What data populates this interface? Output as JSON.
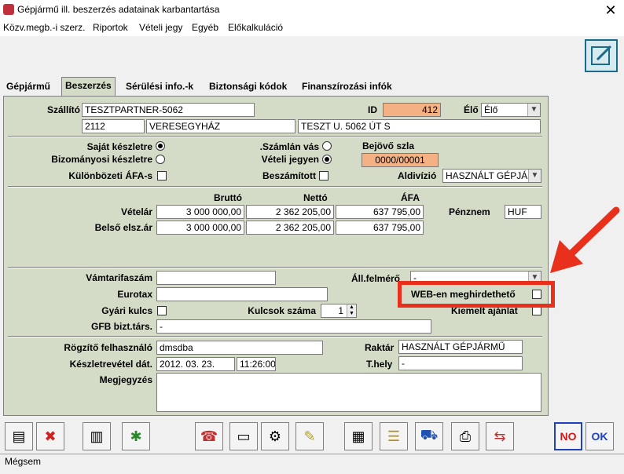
{
  "window": {
    "title": "Gépjármű ill. beszerzés adatainak karbantartása",
    "close": "✕"
  },
  "menu": [
    "Közv.megb.-i szerz.",
    "Riportok",
    "Vételi jegy",
    "Egyéb",
    "Előkalkuláció"
  ],
  "tabs": [
    "Gépjármű",
    "Beszerzés",
    "Sérülési info.-k",
    "Biztonsági kódok",
    "Finanszírozási infók"
  ],
  "active_tab": "Beszerzés",
  "supplier": {
    "label": "Szállító",
    "name": "TESZTPARTNER-5062",
    "zip": "2112",
    "city": "VERESEGYHÁZ",
    "street": "TESZT U. 5062 ÚT S",
    "id_label": "ID",
    "id": "412",
    "alive_label": "Élő",
    "alive": "Élő"
  },
  "stock": {
    "own_label": "Saját készletre",
    "commission_label": "Bizományosi készletre",
    "diff_vat_label": "Különbözeti ÁFA-s",
    "invoice_label": ".Számlán vás",
    "purchase_ticket_label": "Vételi jegyen",
    "offset_label": "Beszámított",
    "incoming_label": "Bejövő szla",
    "incoming_value": "0000/00001",
    "subdivision_label": "Aldivízió",
    "subdivision": "HASZNÁLT GÉPJÁ"
  },
  "prices": {
    "gross_label": "Bruttó",
    "net_label": "Nettó",
    "vat_label": "ÁFA",
    "purchase_label": "Vételár",
    "internal_label": "Belső elsz.ár",
    "purchase": {
      "gross": "3 000 000,00",
      "net": "2 362 205,00",
      "vat": "637 795,00"
    },
    "internal": {
      "gross": "3 000 000,00",
      "net": "2 362 205,00",
      "vat": "637 795,00"
    },
    "currency_label": "Pénznem",
    "currency": "HUF"
  },
  "misc": {
    "customs_label": "Vámtarifaszám",
    "eurotax_label": "Eurotax",
    "factory_keys_label": "Gyári kulcs",
    "key_count_label": "Kulcsok száma",
    "key_count": "1",
    "gfb_label": "GFB bizt.társ.",
    "gfb": "-",
    "state_label": "Áll.felmérő",
    "state": "-",
    "web_label": "WEB-en meghirdethető",
    "featured_label": "Kiemelt ajánlat"
  },
  "record": {
    "user_label": "Rögzítő felhasználó",
    "user": "dmsdba",
    "date_label": "Készletrevétel dát.",
    "date": "2012. 03. 23.",
    "time": "11:26:00",
    "note_label": "Megjegyzés",
    "warehouse_label": "Raktár",
    "warehouse": "HASZNÁLT GÉPJÁRMŰ",
    "place_label": "T.hely",
    "place": "-"
  },
  "buttons": {
    "no": "NO",
    "ok": "OK"
  },
  "status": "Mégsem",
  "colors": {
    "panel": "#d4dcc8",
    "highlight": "#e8301c",
    "orange_field": "#f4b183"
  }
}
